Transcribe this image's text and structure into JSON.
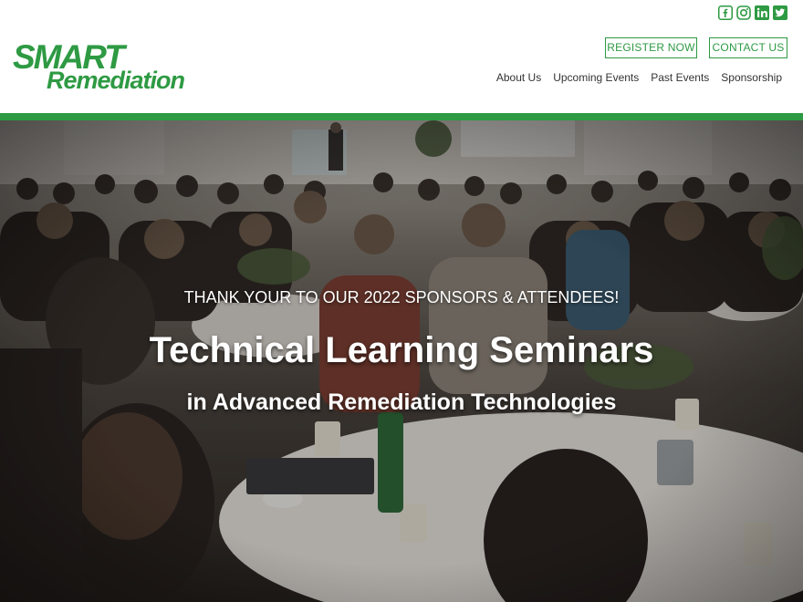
{
  "brand": {
    "logo_line1": "SMART",
    "logo_line2": "Remediation",
    "color": "#2e9a43"
  },
  "social": [
    {
      "icon": "facebook-icon"
    },
    {
      "icon": "instagram-icon"
    },
    {
      "icon": "linkedin-icon"
    },
    {
      "icon": "twitter-icon"
    }
  ],
  "header": {
    "register_label": "REGISTER NOW",
    "contact_label": "CONTACT US"
  },
  "nav": {
    "items": [
      {
        "label": "About Us"
      },
      {
        "label": "Upcoming Events"
      },
      {
        "label": "Past Events"
      },
      {
        "label": "Sponsorship"
      }
    ]
  },
  "hero": {
    "subheading": "THANK YOUR TO OUR 2022 SPONSORS & ATTENDEES!",
    "title": "Technical Learning Seminars",
    "tagline": "in Advanced Remediation Technologies"
  }
}
